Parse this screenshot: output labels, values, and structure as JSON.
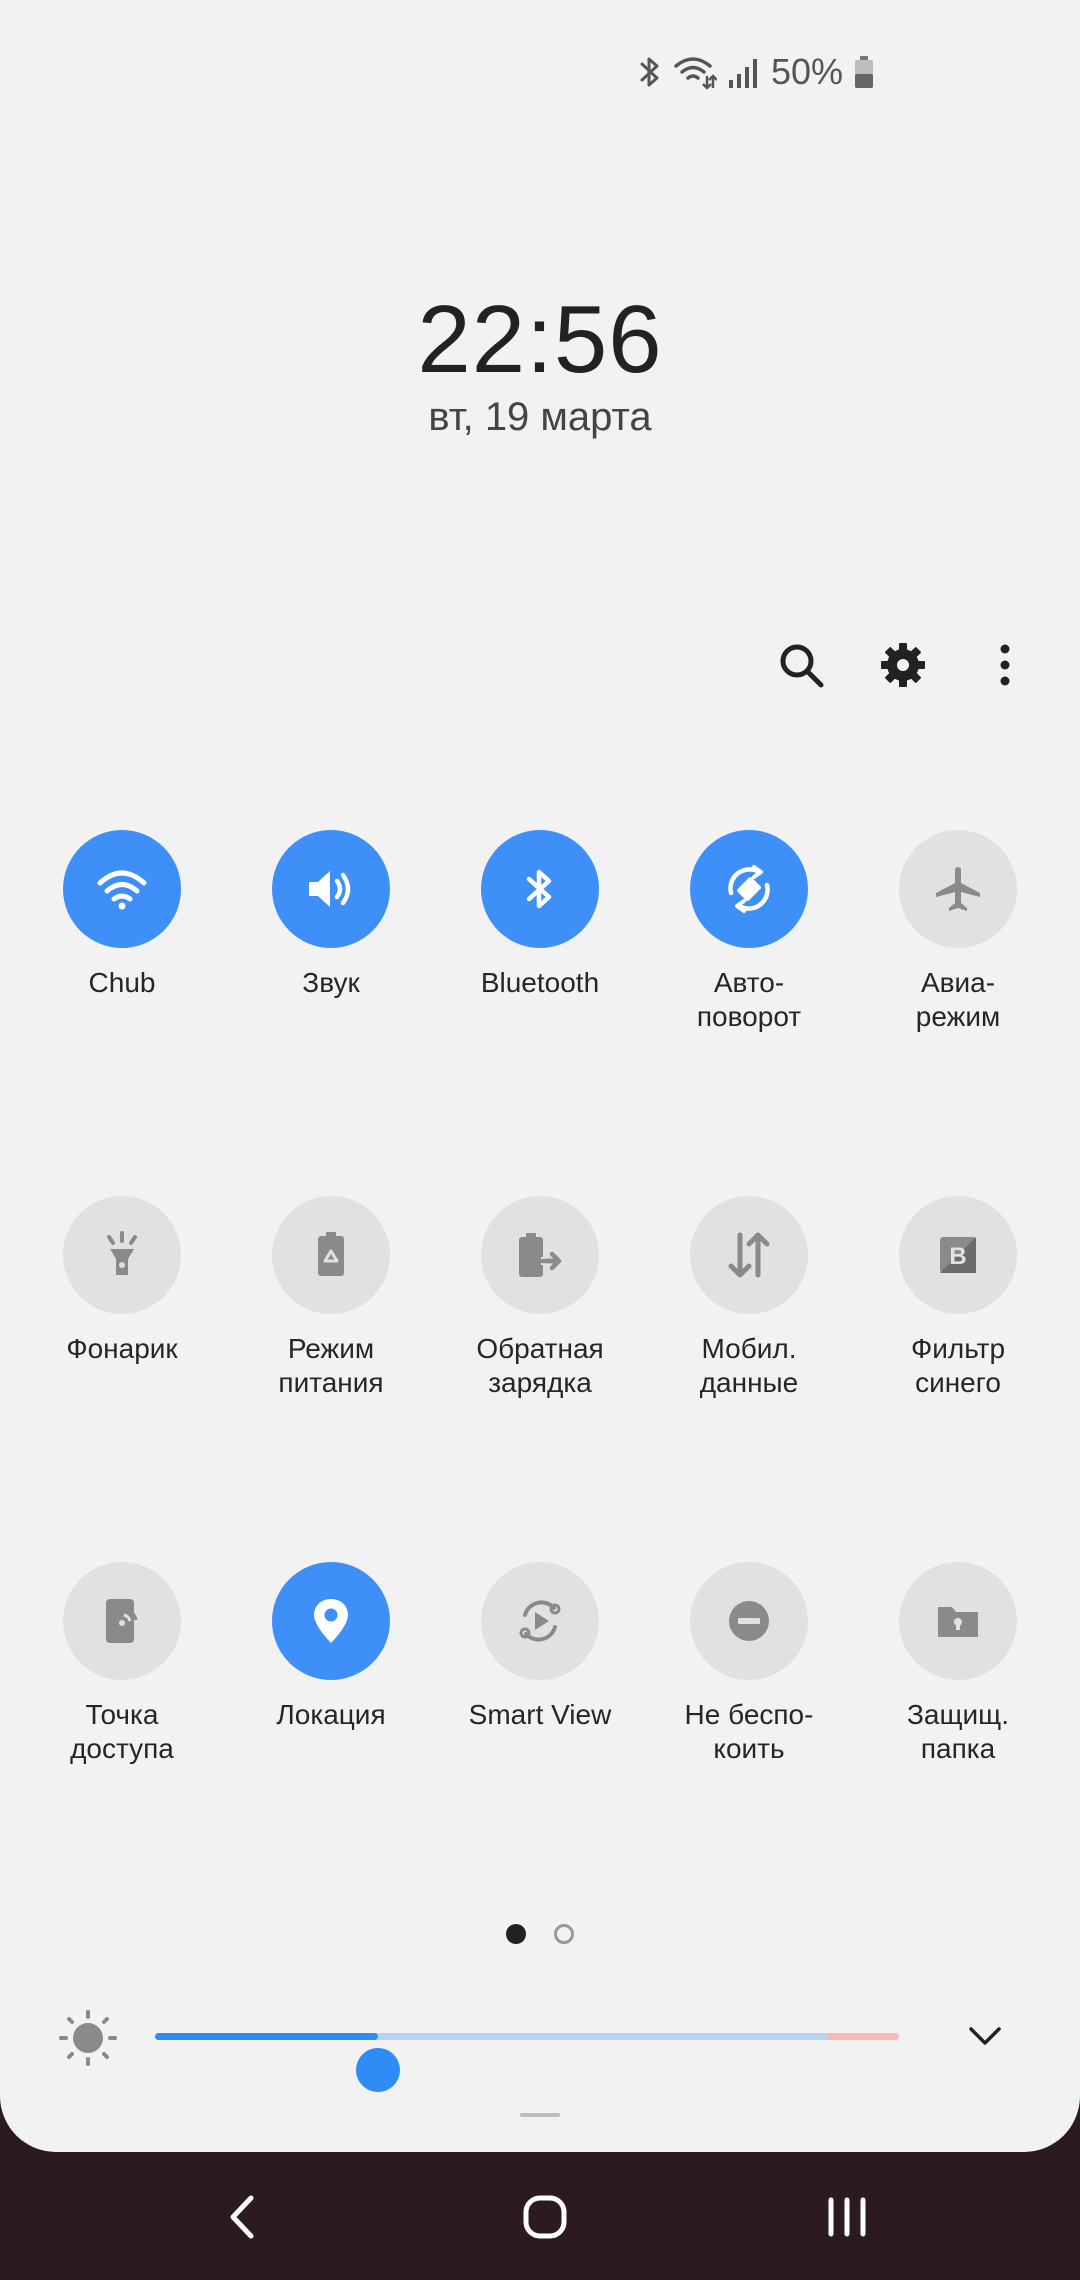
{
  "status_bar": {
    "battery_percent": "50%",
    "icons": [
      "bluetooth-icon",
      "wifi-icon",
      "signal-icon",
      "battery-icon"
    ]
  },
  "lockscreen": {
    "time": "22:56",
    "date": "вт, 19 марта"
  },
  "header_actions": [
    "search-icon",
    "gear-icon",
    "more-vertical-icon"
  ],
  "quick_tiles": [
    {
      "id": "wifi",
      "label": "Chub",
      "icon": "wifi-icon",
      "on": true
    },
    {
      "id": "sound",
      "label": "Звук",
      "icon": "volume-icon",
      "on": true
    },
    {
      "id": "bluetooth",
      "label": "Bluetooth",
      "icon": "bluetooth-icon",
      "on": true
    },
    {
      "id": "autorotate",
      "label": "Авто-\nповорот",
      "icon": "rotate-icon",
      "on": true
    },
    {
      "id": "airplane",
      "label": "Авиа-\nрежим",
      "icon": "airplane-icon",
      "on": false
    },
    {
      "id": "flashlight",
      "label": "Фонарик",
      "icon": "flashlight-icon",
      "on": false
    },
    {
      "id": "power-mode",
      "label": "Режим\nпитания",
      "icon": "battery-saver-icon",
      "on": false
    },
    {
      "id": "reverse-charge",
      "label": "Обратная\nзарядка",
      "icon": "wireless-powershare-icon",
      "on": false
    },
    {
      "id": "mobile-data",
      "label": "Мобил.\nданные",
      "icon": "data-arrows-icon",
      "on": false
    },
    {
      "id": "blue-filter",
      "label": "Фильтр\nсинего",
      "icon": "blue-light-filter-icon",
      "on": false
    },
    {
      "id": "hotspot",
      "label": "Точка\nдоступа",
      "icon": "hotspot-icon",
      "on": false
    },
    {
      "id": "location",
      "label": "Локация",
      "icon": "location-pin-icon",
      "on": true
    },
    {
      "id": "smart-view",
      "label": "Smart View",
      "icon": "smart-view-icon",
      "on": false
    },
    {
      "id": "dnd",
      "label": "Не беспо-\nкоить",
      "icon": "do-not-disturb-icon",
      "on": false
    },
    {
      "id": "secure-folder",
      "label": "Защищ.\nпапка",
      "icon": "secure-folder-icon",
      "on": false
    }
  ],
  "pager": {
    "pages": 2,
    "current": 1
  },
  "brightness": {
    "level": 0.3
  },
  "colors": {
    "accent": "#3e8ff7",
    "tile_off": "#e1e1e3",
    "panel_bg": "#f2f2f3",
    "navbar_bg": "#2b1a1e"
  },
  "navigation": [
    "back-icon",
    "home-icon",
    "recents-icon"
  ]
}
